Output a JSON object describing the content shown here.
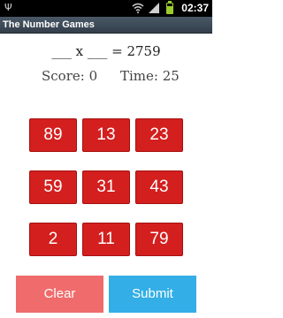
{
  "status_bar": {
    "time": "02:37",
    "icons": [
      "usb-icon",
      "wifi-icon",
      "signal-icon",
      "battery-icon"
    ],
    "battery_color": "#9ccc2c"
  },
  "app": {
    "title": "The Number Games"
  },
  "equation": {
    "text": "___ x ___ = 2759"
  },
  "stats": {
    "score": "Score: 0",
    "time": "Time: 25"
  },
  "numbers": [
    "89",
    "13",
    "23",
    "59",
    "31",
    "43",
    "2",
    "11",
    "79"
  ],
  "actions": {
    "clear": "Clear",
    "submit": "Submit"
  },
  "colors": {
    "number_button": "#d41f1f",
    "clear_button": "#f06b6b",
    "submit_button": "#33aee6"
  }
}
